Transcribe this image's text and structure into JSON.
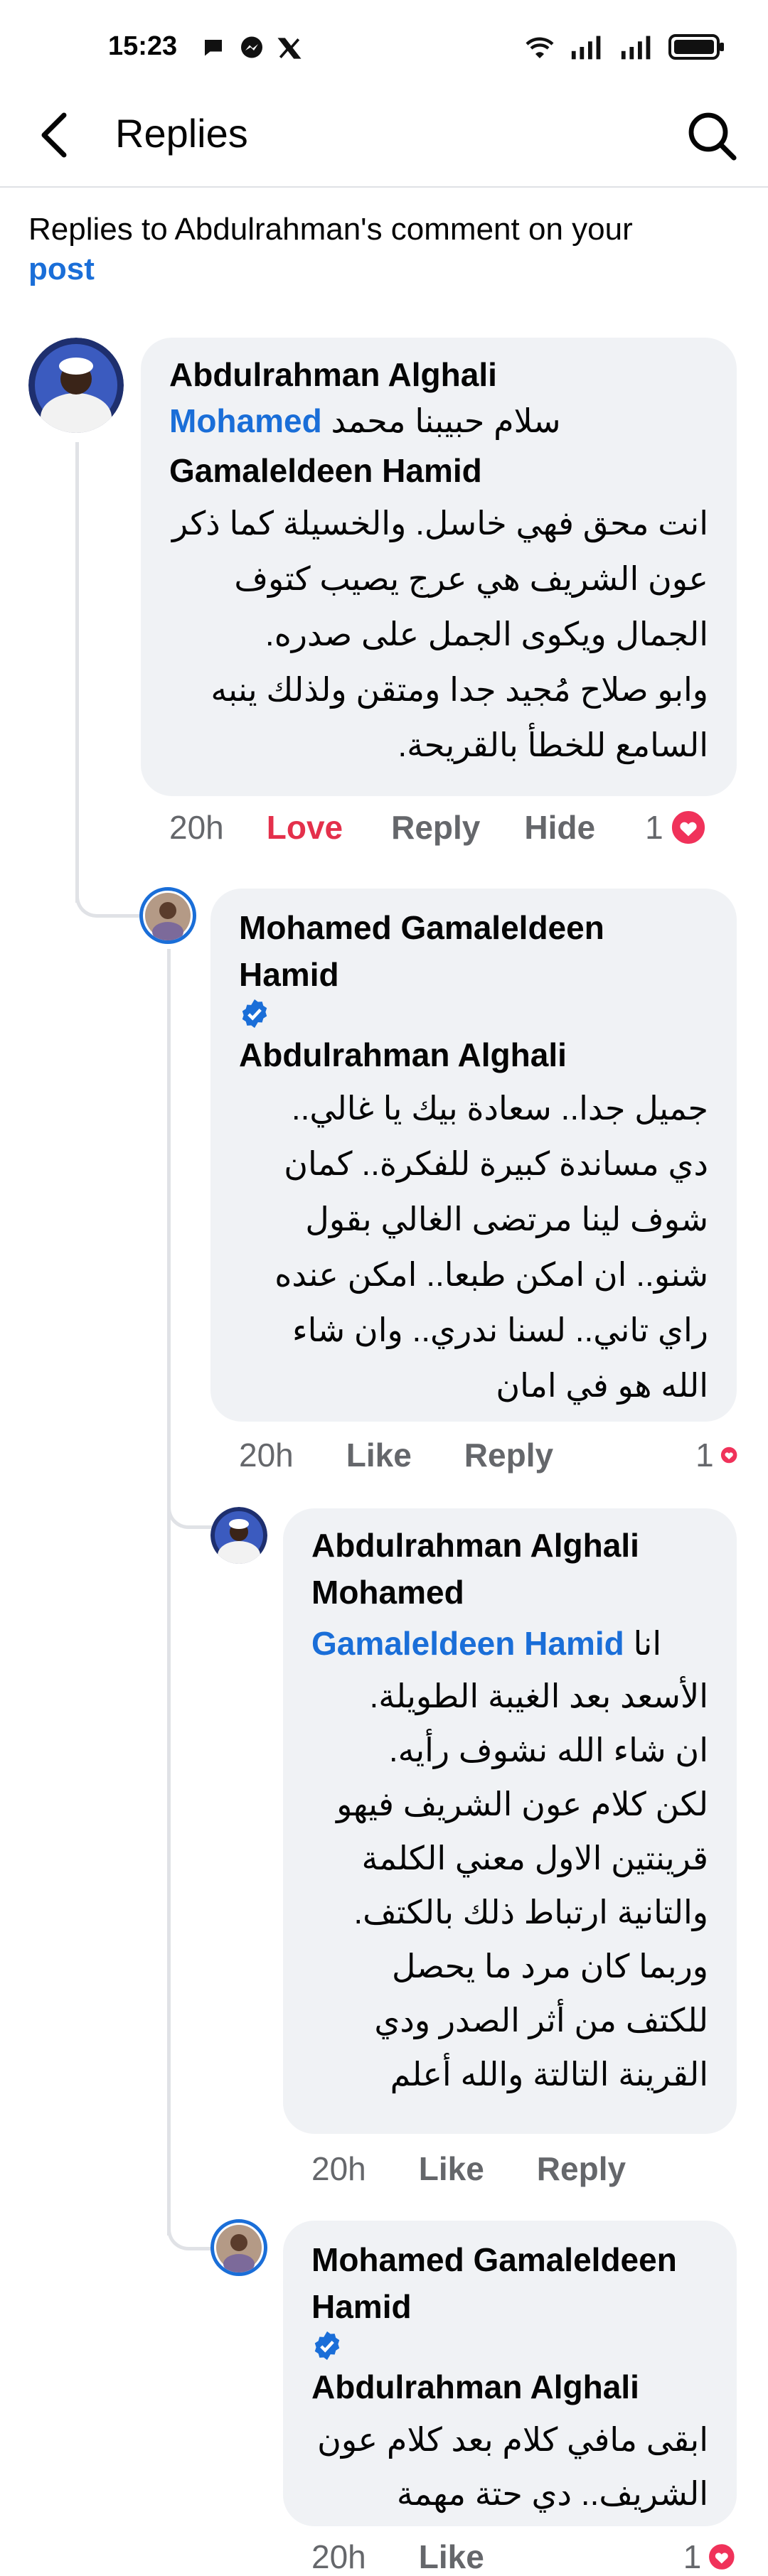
{
  "status_bar": {
    "time": "15:23"
  },
  "header": {
    "title": "Replies"
  },
  "context": {
    "text": "Replies to Abdulrahman's comment on your",
    "link": "post"
  },
  "comments": [
    {
      "author": "Abdulrahman Alghali",
      "mention_name": "Mohamed Gamaleldeen Hamid",
      "mention_line1": "Mohamed",
      "mention_line2": "Gamaleldeen Hamid",
      "greeting": "سلام حبيبنا محمد",
      "lines": [
        "انت محق فهي خاسل. والخسيلة كما ذكر",
        "عون الشريف هي عرج يصيب كتوف",
        "الجمال ويكوى الجمل على صدره.",
        "وابو صلاح مُجيد جدا ومتقن ولذلك ينبه",
        "السامع للخطأ بالقريحة."
      ],
      "time": "20h",
      "reaction_label": "Love",
      "reply_label": "Reply",
      "hide_label": "Hide",
      "reaction_count": "1"
    },
    {
      "author_line1": "Mohamed Gamaleldeen",
      "author_line2": "Hamid",
      "mention": "Abdulrahman Alghali",
      "lines": [
        "جميل جدا.. سعادة بيك يا غالي..",
        "دي مساندة كبيرة للفكرة.. كمان",
        "شوف لينا مرتضى الغالي بقول",
        "شنو.. ان امكن طبعا.. امكن عنده",
        "راي تاني.. لسنا ندري..  وان شاء",
        "الله هو في امان"
      ],
      "time": "20h",
      "like_label": "Like",
      "reply_label": "Reply",
      "reaction_count": "1"
    },
    {
      "author": "Abdulrahman Alghali",
      "mention_line1": "Mohamed",
      "mention_line2": "Gamaleldeen Hamid",
      "inline_text": "انا",
      "lines": [
        "الأسعد بعد الغيبة الطويلة.",
        "ان شاء الله نشوف رأيه.",
        "لكن كلام عون الشريف فيهو",
        "قرينتين الاول معني الكلمة",
        "والتانية ارتباط ذلك بالكتف.",
        "وربما كان مرد ما يحصل",
        "للكتف من أثر الصدر ودي",
        "القرينة التالتة والله أعلم"
      ],
      "time": "20h",
      "like_label": "Like",
      "reply_label": "Reply"
    },
    {
      "author_line1": "Mohamed Gamaleldeen",
      "author_line2": "Hamid",
      "mention": "Abdulrahman Alghali",
      "lines": [
        "ابقى مافي كلام بعد كلام عون",
        "الشريف.. دي حتة مهمة"
      ],
      "time": "20h",
      "like_label": "Like",
      "reaction_count": "1"
    }
  ],
  "colors": {
    "accent": "#1a6ed8",
    "love": "#e4304b",
    "bubble": "#f0f2f5",
    "secondary_text": "#65676b"
  },
  "icons": [
    "back-arrow-icon",
    "search-icon",
    "verified-badge-icon",
    "heart-reaction-icon",
    "wifi-icon",
    "signal-icon",
    "battery-icon",
    "chat-icon",
    "messenger-icon",
    "x-logo-icon"
  ]
}
